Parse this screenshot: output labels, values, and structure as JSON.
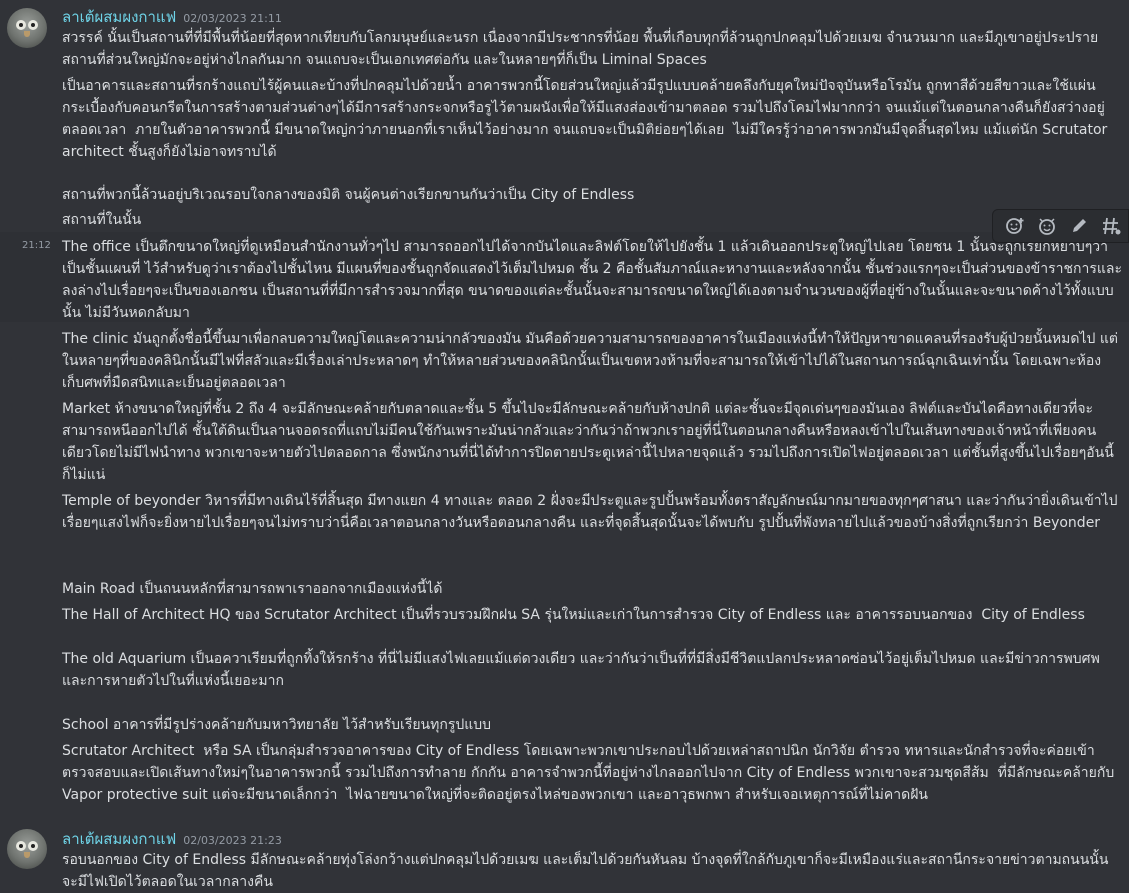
{
  "colors": {
    "background": "#313338",
    "username": "#6fd4e8",
    "text": "#dbdee1",
    "muted": "#949ba4"
  },
  "messages": [
    {
      "author": "ลาเต้ผสมผงกาแฟ",
      "timestamp": "02/03/2023 21:11",
      "paragraphs": [
        "สวรรค์ นั้นเป็นสถานที่ที่มีพื้นที่น้อยที่สุดหากเทียบกับโลกมนุษย์และนรก เนื่องจากมีประชากรที่น้อย พื้นที่เกือบทุกที่ล้วนถูกปกคลุมไปด้วยเมฆ จำนวนมาก และมีภูเขาอยู่ประปราย สถานที่ส่วนใหญ่มักจะอยู่ห่างไกลกันมาก จนแถบจะเป็นเอกเทศต่อกัน และในหลายๆที่ก็เป็น Liminal Spaces",
        "เป็นอาคารและสถานที่รกร้างแถบไร้ผู้คนและบ้างที่ปกคลุมไปด้วยน้ำ อาคารพวกนี้โดยส่วนใหญ่แล้วมีรูปแบบคล้ายคลึงกับยุคใหม่ปัจจุบันหรือโรมัน ถูกทาสีด้วยสีขาวและใช้แผ่นกระเบื้องกับคอนกรีตในการสร้างตามส่วนต่างๆได้มีการสร้างกระจกหรือรูไว้ตามผนังเพื่อให้มีแสงส่องเข้ามาตลอด รวมไปถึงโคมไฟมากกว่า จนแม้แต่ในตอนกลางคืนก็ยังสว่างอยู่ตลอดเวลา  ภายในตัวอาคารพวกนี้ มีขนาดใหญ่กว่าภายนอกที่เราเห็นไว้อย่างมาก จนแถบจะเป็นมิติย่อยๆได้เลย  ไม่มีใครรู้ว่าอาคารพวกมันมีจุดสิ้นสุดไหม แม้แต่นัก Scrutator architect ชั้นสูงก็ยังไม่อาจทราบได้",
        "สถานที่พวกนี้ล้วนอยู่บริเวณรอบใจกลางของมิติ จนผู้คนต่างเรียกขานกันว่าเป็น City of Endless",
        "สถานที่ในนั้น"
      ]
    },
    {
      "side_time": "21:12",
      "paragraphs": [
        "The office เป็นตึกขนาดใหญ่ที่ดูเหมือนสำนักงานทั่วๆไป สามารถออกไปได้จากบันไดและลิฟต์โดยให้ไปยังชั้น 1 แล้วเดินออกประตูใหญ่ไปเลย โดยชน 1 นั้นจะถูกเรียกหยาบๆว่า เป็นชั้นแผนที่ ไว้สำหรับดูว่าเราต้องไปชั้นไหน มีแผนที่ของชั้นถูกจัดแสดงไว้เต็มไปหมด ชั้น 2 คือชั้นสัมภาณ์และหางานและหลังจากนั้น ชั้นช่วงแรกๆจะเป็นส่วนของข้าราชการและลงล่างไปเรื่อยๆจะเป็นของเอกชน เป็นสถานที่ที่มีการสำรวจมากที่สุด ขนาดของแต่ละชั้นนั้นจะสามารถขนาดใหญ่ได้เองตามจำนวนของผู้ที่อยู่ข้างในนั้นและจะขนาดค้างไว้ทั้งแบบนั้น ไม่มีวันหดกลับมา",
        "The clinic มันถูกตั้งชื่อนี้ขึ้นมาเพื่อกลบความใหญ่โตและความน่ากลัวของมัน มันคือด้วยความสามารถของอาคารในเมืองแห่งนี้ทำให้ปัญหาขาดแคลนที่รองรับผู้ป่วยนั้นหมดไป แต่ในหลายๆที่ของคลินิกนั้นมีไฟที่สลัวและมีเรื่องเล่าประหลาดๆ ทำให้หลายส่วนของคลินิกนั้นเป็นเขตหวงห้ามที่จะสามารถให้เข้าไปได้ในสถานการณ์ฉุกเฉินเท่านั้น โดยเฉพาะห้องเก็บศพที่มืดสนิทและเย็นอยู่ตลอดเวลา",
        "Market ห้างขนาดใหญ่ที่ชั้น 2 ถึง 4 จะมีลักษณะคล้ายกับตลาดและชั้น 5 ขึ้นไปจะมีลักษณะคล้ายกับห้างปกติ แต่ละชั้นจะมีจุดเด่นๆของมันเอง ลิฟต์และบันไดคือทางเดียวที่จะสามารถหนีออกไปได้ ชั้นใต้ดินเป็นลานจอดรถที่แถบไม่มีคนใช้กันเพราะมันน่ากลัวและว่ากันว่าถ้าพวกเราอยู่ที่นี่ในตอนกลางคืนหรือหลงเข้าไปในเส้นทางของเจ้าหน้าที่เพียงคนเดียวโดยไม่มีไฟนำทาง พวกเขาจะหายตัวไปตลอดกาล ซึ่งพนักงานที่นี่ได้ทำการปิดตายประตูเหล่านี้ไปหลายจุดแล้ว รวมไปถึงการเปิดไฟอยู่ตลอดเวลา แต่ชั้นที่สูงขึ้นไปเรื่อยๆอันนี้ก็ไม่แน่",
        "Temple of beyonder วิหารที่มีทางเดินไร้ที่สิ้นสุด มีทางแยก 4 ทางและ ตลอด 2 ฝั่งจะมีประตูและรูปปั้นพร้อมทั้งตราสัญลักษณ์มากมายของทุกๆศาสนา และว่ากันว่ายิ่งเดินเข้าไปเรื่อยๆแสงไฟก็จะยิ่งหายไปเรื่อยๆจนไม่ทราบว่านี่คือเวลาตอนกลางวันหรือตอนกลางคืน และที่จุดสิ้นสุดนั้นจะได้พบกับ รูปปั้นที่พังทลายไปแล้วของบ้างสิ่งที่ถูกเรียกว่า Beyonder",
        "Main Road เป็นถนนหลักที่สามารถพาเราออกจากเมืองแห่งนี้ได้",
        "The Hall of Architect HQ ของ Scrutator Architect เป็นที่รวบรวมฝึกฝน SA รุ่นใหม่และเก่าในการสำรวจ City of Endless และ อาคารรอบนอกของ  City of Endless",
        "The old Aquarium เป็นอควาเรียมที่ถูกทิ้งให้รกร้าง ที่นี่ไม่มีแสงไฟเลยแม้แต่ดวงเดียว และว่ากันว่าเป็นที่ที่มีสิ่งมีชีวิตแปลกประหลาดซ่อนไว้อยู่เต็มไปหมด และมีข่าวการพบศพและการหายตัวไปในที่แห่งนี้เยอะมาก",
        "School อาคารที่มีรูปร่างคล้ายกับมหาวิทยาลัย ไว้สำหรับเรียนทุกรูปแบบ",
        "Scrutator Architect  หรือ SA เป็นกลุ่มสำรวจอาคารของ City of Endless โดยเฉพาะพวกเขาประกอบไปด้วยเหล่าสถาปนิก นักวิจัย ตำรวจ ทหารและนักสำรวจที่จะค่อยเข้าตรวจสอบและเปิดเส้นทางใหม่ๆในอาคารพวกนี้ รวมไปถึงการทำลาย กักกัน อาคารจำพวกนี้ที่อยู่ห่างไกลออกไปจาก City of Endless พวกเขาจะสวมชุดสีส้ม  ที่มีลักษณะคล้ายกับ Vapor protective suit แต่จะมีขนาดเล็กกว่า  ไฟฉายขนาดใหญ่ที่จะติดอยู่ตรงไหล่ของพวกเขา และอาวุธพกพา สำหรับเจอเหตุการณ์ที่ไม่คาดฝัน"
      ]
    },
    {
      "author": "ลาเต้ผสมผงกาแฟ",
      "timestamp": "02/03/2023 21:23",
      "paragraphs": [
        "รอบนอกของ City of Endless มีลักษณะคล้ายทุ่งโล่งกว้างแต่ปกคลุมไปด้วยเมฆ และเต็มไปด้วยกันหันลม บ้างจุดที่ใกล้กับภูเขาก็จะมีเหมืองแร่และสถานีกระจายข่าวตามถนนนั้นจะมีไฟเปิดไว้ตลอดในเวลากลางคืน"
      ]
    }
  ],
  "toolbar": {
    "icons": [
      "add-reaction-icon",
      "super-reaction-icon",
      "edit-icon",
      "thread-icon"
    ]
  }
}
